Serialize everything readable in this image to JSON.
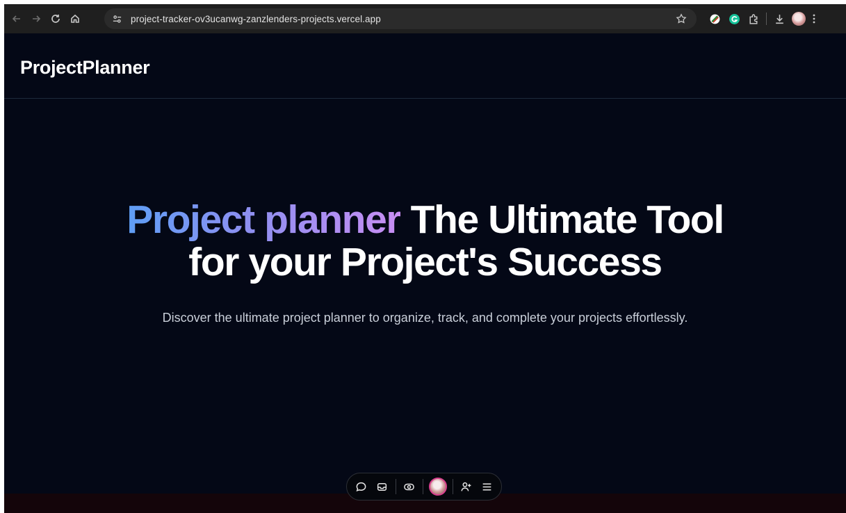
{
  "browser": {
    "url": "project-tracker-ov3ucanwg-zanzlenders-projects.vercel.app",
    "icons": [
      "back-icon",
      "forward-icon",
      "reload-icon",
      "home-icon",
      "site-info-icon",
      "bookmark-star-icon",
      "extension-icon",
      "grammarly-icon",
      "puzzle-icon",
      "download-icon",
      "profile-avatar",
      "menu-icon"
    ]
  },
  "app": {
    "brand": "ProjectPlanner"
  },
  "hero": {
    "title_highlight": "Project planner",
    "title_rest": " The Ultimate Tool for your Project's Success",
    "subtitle": "Discover the ultimate project planner to organize, track, and complete your projects effortlessly."
  },
  "toolbar": {
    "icons": [
      "comment-icon",
      "inbox-icon",
      "eye-icon",
      "user-avatar",
      "add-user-icon",
      "menu-icon"
    ]
  },
  "colors": {
    "background": "#040816",
    "gradient_start": "#5f9ef5",
    "gradient_end": "#c88ef3",
    "text_primary": "#ffffff",
    "text_secondary": "#c9cfd9"
  }
}
